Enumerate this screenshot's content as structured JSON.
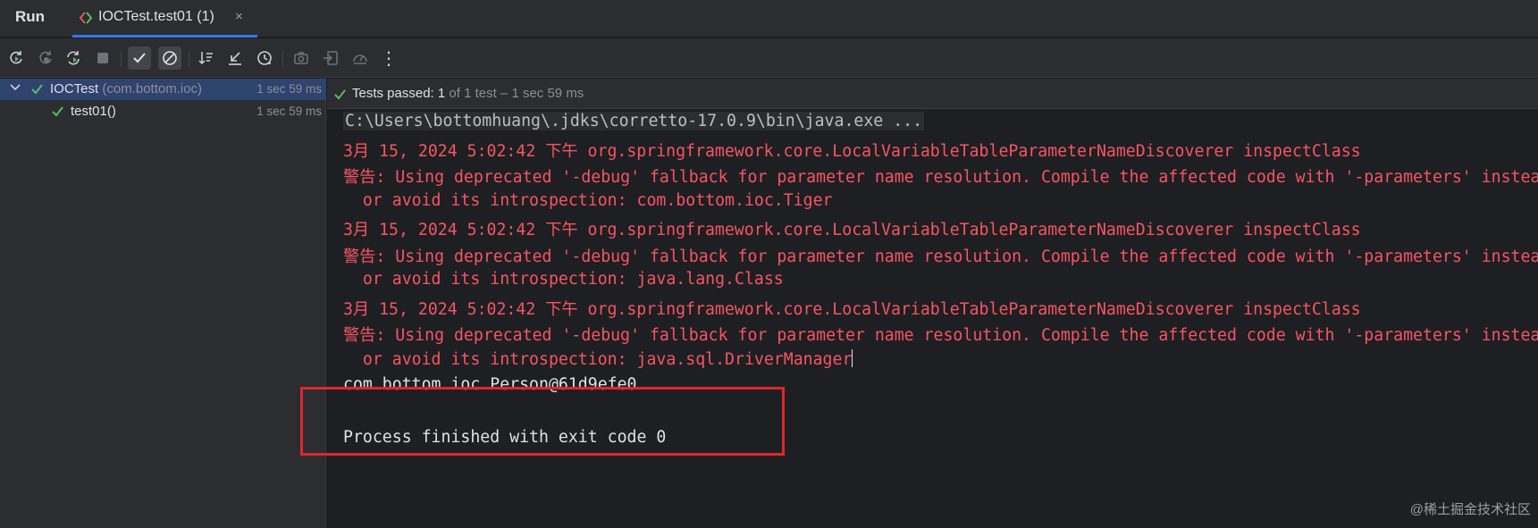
{
  "tabs": {
    "run_label": "Run",
    "active_label": "IOCTest.test01 (1)",
    "close_glyph": "×"
  },
  "toolbar": {
    "buttons": [
      "rerun-icon",
      "rerun-failed-icon",
      "toggle-auto-test-icon",
      "stop-icon",
      "show-passed-icon",
      "show-ignored-icon",
      "sort-alphabetically-icon",
      "collapse-icon",
      "sort-by-duration-icon",
      "screenshot-icon",
      "import-tests-icon",
      "test-history-icon",
      "more-icon"
    ],
    "more_glyph": "⋮"
  },
  "tree": {
    "root": {
      "name": "IOCTest",
      "package": "(com.bottom.ioc)",
      "time": "1 sec 59 ms"
    },
    "child": {
      "name": "test01()",
      "time": "1 sec 59 ms"
    }
  },
  "status": {
    "prefix": "Tests passed: ",
    "passed": "1",
    "suffix": " of 1 test – 1 sec 59 ms"
  },
  "console": {
    "command": "C:\\Users\\bottomhuang\\.jdks\\corretto-17.0.9\\bin\\java.exe ...",
    "lines": [
      "3月 15, 2024 5:02:42 下午 org.springframework.core.LocalVariableTableParameterNameDiscoverer inspectClass",
      "警告: Using deprecated '-debug' fallback for parameter name resolution. Compile the affected code with '-parameters' instea",
      "  or avoid its introspection: com.bottom.ioc.Tiger",
      "3月 15, 2024 5:02:42 下午 org.springframework.core.LocalVariableTableParameterNameDiscoverer inspectClass",
      "警告: Using deprecated '-debug' fallback for parameter name resolution. Compile the affected code with '-parameters' instea",
      "  or avoid its introspection: java.lang.Class",
      "3月 15, 2024 5:02:42 下午 org.springframework.core.LocalVariableTableParameterNameDiscoverer inspectClass",
      "警告: Using deprecated '-debug' fallback for parameter name resolution. Compile the affected code with '-parameters' instea",
      "  or avoid its introspection: java.sql.DriverManager"
    ],
    "output": "com.bottom.ioc.Person@61d9efe0",
    "exit": "Process finished with exit code 0"
  },
  "watermark": "@稀土掘金技术社区",
  "colors": {
    "error_text": "#f75464",
    "accent": "#3574f0",
    "pass_green": "#5fb865",
    "highlight_red": "#e0262d"
  }
}
